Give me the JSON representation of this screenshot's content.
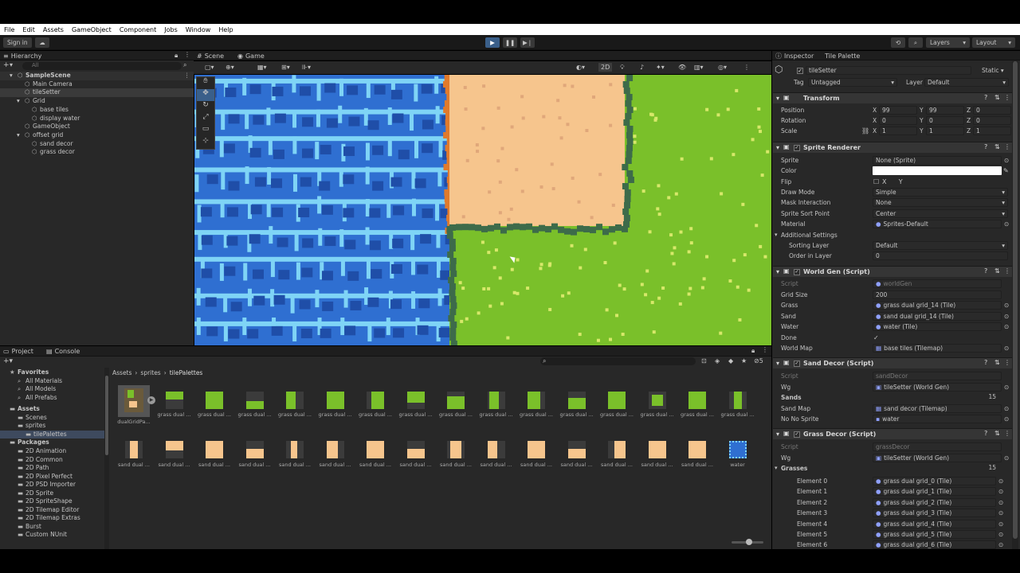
{
  "menu": [
    "File",
    "Edit",
    "Assets",
    "GameObject",
    "Component",
    "Jobs",
    "Window",
    "Help"
  ],
  "toolbar": {
    "sign_in": "Sign in",
    "layers": "Layers",
    "layout": "Layout"
  },
  "hierarchy": {
    "tab": "Hierarchy",
    "search_placeholder": "All",
    "items": [
      {
        "label": "SampleScene",
        "level": 0
      },
      {
        "label": "Main Camera",
        "level": 1
      },
      {
        "label": "tileSetter",
        "level": 1
      },
      {
        "label": "Grid",
        "level": 1
      },
      {
        "label": "base tiles",
        "level": 2
      },
      {
        "label": "display water",
        "level": 2
      },
      {
        "label": "GameObject",
        "level": 1
      },
      {
        "label": "offset grid",
        "level": 1
      },
      {
        "label": "sand decor",
        "level": 2
      },
      {
        "label": "grass decor",
        "level": 2
      }
    ]
  },
  "scene": {
    "tab_scene": "Scene",
    "tab_game": "Game",
    "mode_2d": "2D"
  },
  "project": {
    "tab_project": "Project",
    "tab_console": "Console",
    "breadcrumb": [
      "Assets",
      "sprites",
      "tilePalettes"
    ],
    "hidden_count": "5",
    "favorites": {
      "label": "Favorites",
      "items": [
        "All Materials",
        "All Models",
        "All Prefabs"
      ]
    },
    "assets": {
      "label": "Assets",
      "items": [
        "Scenes",
        "sprites",
        "tilePalettes"
      ]
    },
    "packages": {
      "label": "Packages",
      "items": [
        "2D Animation",
        "2D Common",
        "2D Path",
        "2D Pixel Perfect",
        "2D PSD Importer",
        "2D Sprite",
        "2D SpriteShape",
        "2D Tilemap Editor",
        "2D Tilemap Extras",
        "Burst",
        "Custom NUnit"
      ]
    },
    "grid_row1": [
      "dualGridPa...",
      "grass dual ...",
      "grass dual ...",
      "grass dual ...",
      "grass dual ...",
      "grass dual ...",
      "grass dual ...",
      "grass dual ...",
      "grass dual ...",
      "grass dual ...",
      "grass dual ...",
      "grass dual ...",
      "grass dual ...",
      "grass dual ...",
      "grass dual ...",
      "grass dual ..."
    ],
    "grid_row2": [
      "sand dual ...",
      "sand dual ...",
      "sand dual ...",
      "sand dual ...",
      "sand dual ...",
      "sand dual ...",
      "sand dual ...",
      "sand dual ...",
      "sand dual ...",
      "sand dual ...",
      "sand dual ...",
      "sand dual ...",
      "sand dual ...",
      "sand dual ...",
      "sand dual ...",
      "water"
    ]
  },
  "inspector": {
    "tab_inspector": "Inspector",
    "tab_palette": "Tile Palette",
    "object_name": "tileSetter",
    "static_label": "Static",
    "tag_label": "Tag",
    "tag_value": "Untagged",
    "layer_label": "Layer",
    "layer_value": "Default",
    "transform": {
      "title": "Transform",
      "rows": [
        {
          "label": "Position",
          "x": "99",
          "y": "99",
          "z": "0"
        },
        {
          "label": "Rotation",
          "x": "0",
          "y": "0",
          "z": "0"
        },
        {
          "label": "Scale",
          "x": "1",
          "y": "1",
          "z": "1"
        }
      ]
    },
    "sprite_renderer": {
      "title": "Sprite Renderer",
      "rows": [
        {
          "label": "Sprite",
          "value": "None (Sprite)"
        },
        {
          "label": "Color",
          "value": ""
        },
        {
          "label": "Flip",
          "value": "X      Y"
        },
        {
          "label": "Draw Mode",
          "value": "Simple"
        },
        {
          "label": "Mask Interaction",
          "value": "None"
        },
        {
          "label": "Sprite Sort Point",
          "value": "Center"
        },
        {
          "label": "Material",
          "value": "Sprites-Default"
        }
      ],
      "additional": "Additional Settings",
      "sub_rows": [
        {
          "label": "Sorting Layer",
          "value": "Default"
        },
        {
          "label": "Order in Layer",
          "value": "0"
        }
      ]
    },
    "world_gen": {
      "title": "World Gen (Script)",
      "rows": [
        {
          "label": "Script",
          "value": "worldGen"
        },
        {
          "label": "Grid Size",
          "value": "200"
        },
        {
          "label": "Grass",
          "value": "grass dual grid_14 (Tile)"
        },
        {
          "label": "Sand",
          "value": "sand dual grid_14 (Tile)"
        },
        {
          "label": "Water",
          "value": "water (Tile)"
        },
        {
          "label": "Done",
          "value": "✓"
        },
        {
          "label": "World Map",
          "value": "base tiles (Tilemap)"
        }
      ]
    },
    "sand_decor": {
      "title": "Sand Decor (Script)",
      "rows": [
        {
          "label": "Script",
          "value": "sandDecor"
        },
        {
          "label": "Wg",
          "value": "tileSetter (World Gen)"
        },
        {
          "label": "Sands",
          "value": "15"
        },
        {
          "label": "Sand Map",
          "value": "sand decor (Tilemap)"
        },
        {
          "label": "No No Sprite",
          "value": "water"
        }
      ]
    },
    "grass_decor": {
      "title": "Grass Decor (Script)",
      "rows": [
        {
          "label": "Script",
          "value": "grassDecor"
        },
        {
          "label": "Wg",
          "value": "tileSetter (World Gen)"
        },
        {
          "label": "Grasses",
          "value": "15"
        }
      ],
      "elements": [
        {
          "label": "Element 0",
          "value": "grass dual grid_0 (Tile)"
        },
        {
          "label": "Element 1",
          "value": "grass dual grid_1 (Tile)"
        },
        {
          "label": "Element 2",
          "value": "grass dual grid_2 (Tile)"
        },
        {
          "label": "Element 3",
          "value": "grass dual grid_3 (Tile)"
        },
        {
          "label": "Element 4",
          "value": "grass dual grid_4 (Tile)"
        },
        {
          "label": "Element 5",
          "value": "grass dual grid_5 (Tile)"
        },
        {
          "label": "Element 6",
          "value": "grass dual grid_6 (Tile)"
        }
      ]
    }
  },
  "colors": {
    "water": "#2f6fd1",
    "water_light": "#7fd4f6",
    "sand": "#f6c58d",
    "grass": "#7ac02a",
    "grass_dark": "#3d6b4a",
    "orange": "#e07a2c"
  }
}
